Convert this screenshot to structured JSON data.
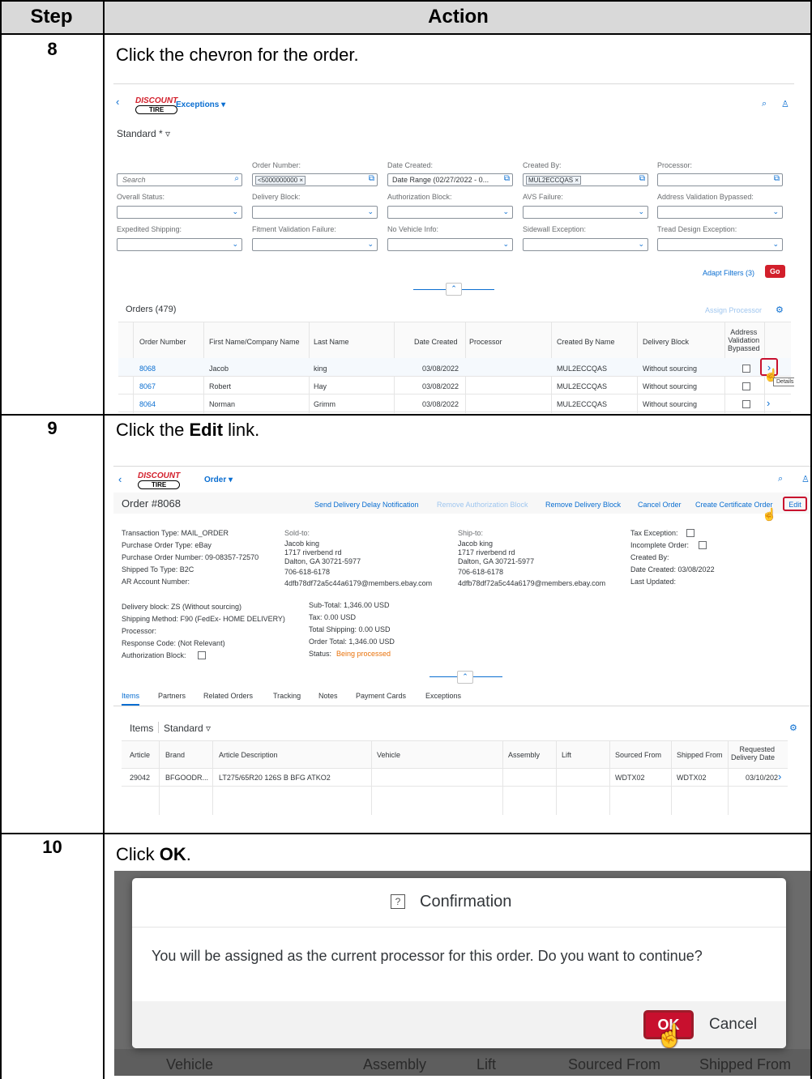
{
  "header": {
    "step": "Step",
    "action": "Action"
  },
  "steps": [
    {
      "num": "8",
      "parts": [
        {
          "t": "Click the chevron for the order.",
          "b": false
        }
      ]
    },
    {
      "num": "9",
      "parts": [
        {
          "t": "Click the ",
          "b": false
        },
        {
          "t": "Edit",
          "b": true
        },
        {
          "t": " link.",
          "b": false
        }
      ]
    },
    {
      "num": "10",
      "parts": [
        {
          "t": "Click ",
          "b": false
        },
        {
          "t": "OK",
          "b": true
        },
        {
          "t": ".",
          "b": false
        }
      ]
    }
  ],
  "logo": {
    "line1": "DISCOUNT",
    "line2": "TIRE"
  },
  "shot1": {
    "app_title": "Exceptions ▾",
    "variant": "Standard * ▿",
    "filters": {
      "order_number_label": "Order Number:",
      "order_number_token": "<5000000000 ×",
      "date_created_label": "Date Created:",
      "date_created_value": "Date Range (02/27/2022 - 0...",
      "created_by_label": "Created By:",
      "created_by_token": "MUL2ECCQAS ×",
      "processor_label": "Processor:",
      "search_placeholder": "Search",
      "overall_status": "Overall Status:",
      "delivery_block": "Delivery Block:",
      "authorization_block": "Authorization Block:",
      "avs_failure": "AVS Failure:",
      "address_validation_bypassed": "Address Validation Bypassed:",
      "expedited_shipping": "Expedited Shipping:",
      "fitment_validation_failure": "Fitment Validation Failure:",
      "no_vehicle_info": "No Vehicle Info:",
      "sidewall_exception": "Sidewall Exception:",
      "tread_design_exception": "Tread Design Exception:"
    },
    "adapt_filters": "Adapt Filters (3)",
    "go": "Go",
    "orders_title": "Orders (479)",
    "assign_processor": "Assign Processor",
    "columns": [
      "Order Number",
      "First Name/Company Name",
      "Last Name",
      "Date Created",
      "Processor",
      "Created By Name",
      "Delivery Block"
    ],
    "address_col": [
      "Address",
      "Validation",
      "Bypassed"
    ],
    "rows": [
      {
        "order": "8068",
        "first": "Jacob",
        "last": "king",
        "date": "03/08/2022",
        "created_by": "MUL2ECCQAS",
        "delivery": "Without sourcing"
      },
      {
        "order": "8067",
        "first": "Robert",
        "last": "Hay",
        "date": "03/08/2022",
        "created_by": "MUL2ECCQAS",
        "delivery": "Without sourcing"
      },
      {
        "order": "8064",
        "first": "Norman",
        "last": "Grimm",
        "date": "03/08/2022",
        "created_by": "MUL2ECCQAS",
        "delivery": "Without sourcing"
      }
    ],
    "tooltip": "Details"
  },
  "shot2": {
    "app_title": "Order ▾",
    "order_title": "Order #8068",
    "actions": [
      "Send Delivery Delay Notification",
      "Remove Authorization Block",
      "Remove Delivery Block",
      "Cancel Order",
      "Create Certificate Order",
      "Edit"
    ],
    "col1": [
      "Transaction Type: MAIL_ORDER",
      "Purchase Order Type: eBay",
      "Purchase Order Number: 09-08357-72570",
      "Shipped To Type: B2C",
      "AR Account Number:"
    ],
    "soldto_label": "Sold-to:",
    "soldto": [
      "Jacob king",
      "1717 riverbend rd",
      "Dalton, GA 30721-5977",
      "706-618-6178",
      "4dfb78df72a5c44a6179@members.ebay.com"
    ],
    "shipto_label": "Ship-to:",
    "shipto": [
      "Jacob king",
      "1717 riverbend rd",
      "Dalton, GA 30721-5977",
      "706-618-6178",
      "4dfb78df72a5c44a6179@members.ebay.com"
    ],
    "col4": [
      "Tax Exception:",
      "Incomplete Order:",
      "Created By:",
      "Date Created: 03/08/2022",
      "Last Updated:"
    ],
    "col5": [
      "Delivery block: ZS (Without sourcing)",
      "Shipping Method: F90 (FedEx- HOME DELIVERY)",
      "Processor:",
      "Response Code: (Not Relevant)",
      "Authorization Block:"
    ],
    "col6": [
      "Sub-Total: 1,346.00 USD",
      "Tax: 0.00 USD",
      "Total Shipping: 0.00 USD",
      "Order Total: 1,346.00 USD"
    ],
    "status_label": "Status:",
    "status_value": "Being processed",
    "tabs": [
      "Items",
      "Partners",
      "Related Orders",
      "Tracking",
      "Notes",
      "Payment Cards",
      "Exceptions"
    ],
    "items_title": "Items",
    "items_variant": "Standard ▿",
    "item_columns": [
      "Article",
      "Brand",
      "Article Description",
      "Vehicle",
      "Assembly",
      "Lift",
      "Sourced From",
      "Shipped From"
    ],
    "req_col": [
      "Requested",
      "Delivery Date"
    ],
    "item_row": {
      "article": "29042",
      "brand": "BFGOODR...",
      "desc": "LT275/65R20 126S B BFG ATKO2",
      "sourced": "WDTX02",
      "shipped": "WDTX02",
      "date": "03/10/202"
    }
  },
  "shot3": {
    "title": "Confirmation",
    "message": "You will be assigned as the current processor for this order. Do you want to continue?",
    "ok": "OK",
    "cancel": "Cancel",
    "bg_columns": [
      "Vehicle",
      "Assembly",
      "Lift",
      "Sourced From",
      "Shipped From"
    ]
  },
  "colors": {
    "brand_red": "#d21f2b",
    "sap_blue": "#0a6ed1",
    "header_gray": "#d9d9d9",
    "highlight_red": "#c8102e"
  }
}
